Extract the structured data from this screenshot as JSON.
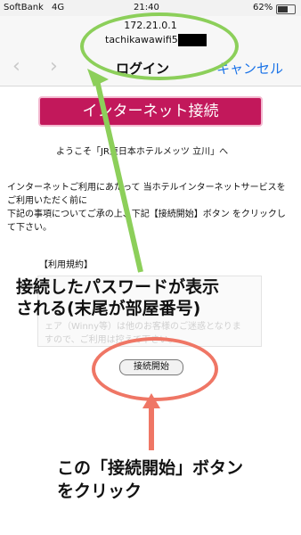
{
  "status_bar": {
    "carrier": "SoftBank",
    "network": "4G",
    "time": "21:40",
    "battery": "62%"
  },
  "nav": {
    "ip": "172.21.0.1",
    "ssid": "tachikawawifi5",
    "back": "‹",
    "forward": "›",
    "title": "ログイン",
    "cancel": "キャンセル"
  },
  "page": {
    "banner": "インターネット接続",
    "welcome": "ようこそ「JR東日本ホテルメッツ 立川」へ",
    "intro_1": "インターネットご利用にあたって 当ホテルインターネットサービスをご利用いただく前に",
    "intro_2": "下記の事項についてご承の上、下記【接続開始】ボタン をクリックして下さい。",
    "rules_heading": "【利用規約】",
    "faded_1": "ェア（Winny等）は他のお客様のご迷惑となりま",
    "faded_2": "すので、ご利用は控えて下さい。",
    "connect_button": "接続開始"
  },
  "annotations": {
    "password_note_1": "接続したパスワードが表示",
    "password_note_2": "される(末尾が部屋番号)",
    "click_note_1": "この「接続開始」ボタン",
    "click_note_2": "をクリック",
    "green": "#8ccf5a",
    "red": "#ef7665"
  }
}
